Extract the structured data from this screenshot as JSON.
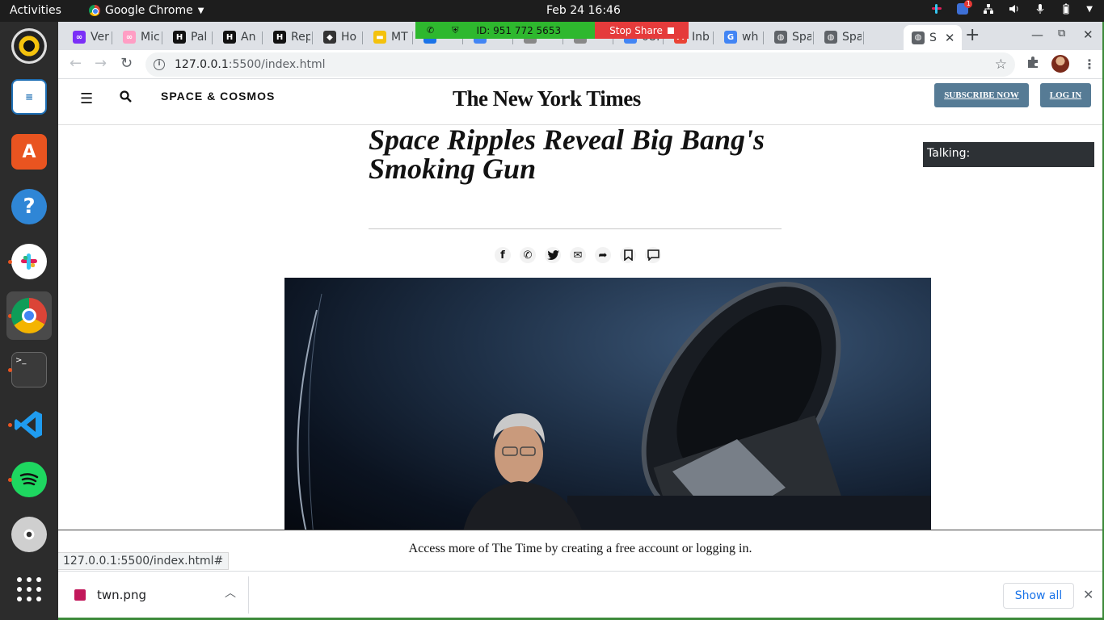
{
  "system": {
    "activities": "Activities",
    "app_name": "Google Chrome",
    "clock": "Feb 24  16:46",
    "notif_badge": "1"
  },
  "dock": {
    "apps": [
      "rhythmbox-icon",
      "libreoffice-impress-icon",
      "ubuntu-software-icon",
      "help-icon",
      "slack-icon",
      "chrome-icon",
      "terminal-icon",
      "vscode-icon",
      "spotify-icon",
      "dvd-icon",
      "app-grid-icon"
    ]
  },
  "tabs": [
    {
      "title": "Ver",
      "fav": "∞",
      "color": "#7b2ff7"
    },
    {
      "title": "Mic",
      "fav": "∞",
      "color": "#ff9ec4"
    },
    {
      "title": "Pal",
      "fav": "H",
      "color": "#111111"
    },
    {
      "title": "An",
      "fav": "H",
      "color": "#111111"
    },
    {
      "title": "Rep",
      "fav": "H",
      "color": "#111111"
    },
    {
      "title": "Ho",
      "fav": "◆",
      "color": "#333333"
    },
    {
      "title": "MT",
      "fav": "▬",
      "color": "#f4c20d"
    },
    {
      "title": "",
      "fav": "",
      "color": "#1a73e8"
    },
    {
      "title": "",
      "fav": "",
      "color": "#4285f4"
    },
    {
      "title": "",
      "fav": "",
      "color": "#888888"
    },
    {
      "title": "",
      "fav": "",
      "color": "#888888"
    },
    {
      "title": "08:",
      "fav": "",
      "color": "#4285f4"
    },
    {
      "title": "Inb",
      "fav": "M",
      "color": "#ea4335"
    },
    {
      "title": "wh",
      "fav": "G",
      "color": "#4285f4"
    },
    {
      "title": "Spa",
      "fav": "◍",
      "color": "#5f6368"
    },
    {
      "title": "Spa",
      "fav": "◍",
      "color": "#5f6368"
    },
    {
      "title": "S",
      "fav": "◍",
      "color": "#5f6368",
      "active": true
    }
  ],
  "screen_share": {
    "id_label": "ID: 951 772 5653",
    "stop_label": "Stop Share"
  },
  "address_bar": {
    "host": "127.0.0.1",
    "path": ":5500/index.html"
  },
  "page": {
    "section": "SPACE & COSMOS",
    "masthead": "The New York Times",
    "subscribe": "SUBSCRIBE NOW",
    "login": "LOG IN",
    "headline": "Space Ripples Reveal Big Bang's Smoking Gun",
    "talking": "Talking:",
    "share_icons": [
      "facebook-icon",
      "whatsapp-icon",
      "twitter-icon",
      "email-icon",
      "share-icon",
      "bookmark-icon",
      "comment-icon"
    ],
    "access_text": "Access more of The Time by creating a free account or logging in.",
    "status_url": "127.0.0.1:5500/index.html#"
  },
  "downloads": {
    "file": "twn.png",
    "show_all": "Show all"
  }
}
